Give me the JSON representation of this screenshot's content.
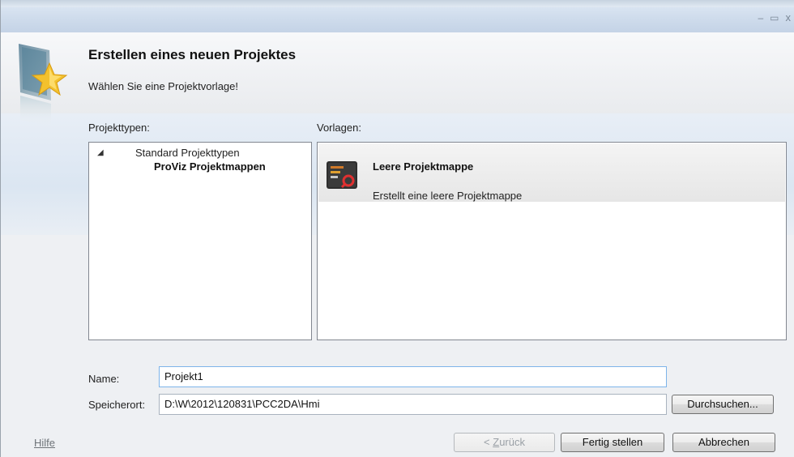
{
  "window": {
    "controls": {
      "minimize": "–",
      "maximize": "▭",
      "close": "x"
    }
  },
  "header": {
    "title": "Erstellen eines neuen Projektes",
    "subtitle": "Wählen Sie eine Projektvorlage!"
  },
  "project_types": {
    "label": "Projekttypen:",
    "root": "Standard Projekttypen",
    "expander": "◢",
    "child": "ProViz Projektmappen"
  },
  "templates": {
    "label": "Vorlagen:",
    "items": [
      {
        "title": "Leere Projektmappe",
        "description": "Erstellt eine leere Projektmappe"
      }
    ]
  },
  "form": {
    "name_label": "Name:",
    "name_value": "Projekt1",
    "location_label": "Speicherort:",
    "location_value": "D:\\W\\2012\\120831\\PCC2DA\\Hmi",
    "browse_button": "Durchsuchen..."
  },
  "footer": {
    "help": "Hilfe",
    "back_prefix": "< ",
    "back_accel": "Z",
    "back_rest": "urück",
    "finish": "Fertig stellen",
    "cancel": "Abbrechen"
  }
}
